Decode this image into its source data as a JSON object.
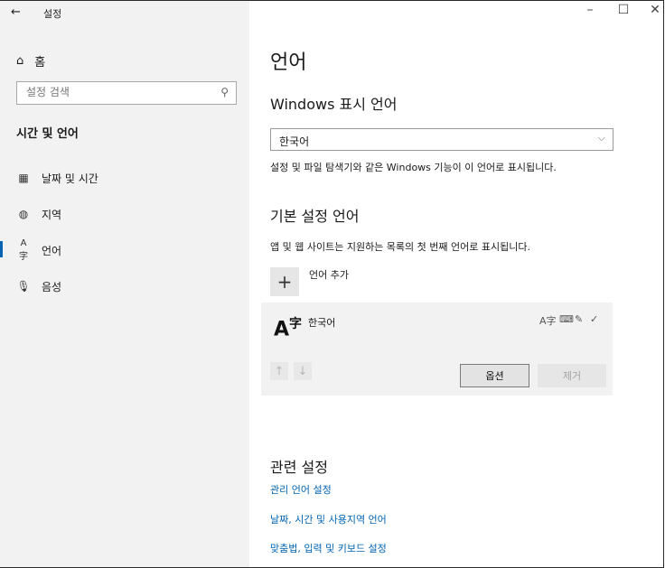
{
  "window": {
    "title": "설정",
    "back": "←",
    "minimize": "–",
    "maximize": "☐",
    "close": "✕"
  },
  "sidebar": {
    "home_label": "홈",
    "search_placeholder": "설정 검색",
    "section_title": "시간 및 언어",
    "items": [
      {
        "label": "날짜 및 시간",
        "icon": "calendar-clock-icon"
      },
      {
        "label": "지역",
        "icon": "globe-icon"
      },
      {
        "label": "언어",
        "icon": "language-icon"
      },
      {
        "label": "음성",
        "icon": "microphone-icon"
      }
    ]
  },
  "main": {
    "page_title": "언어",
    "display_language": {
      "heading": "Windows 표시 언어",
      "selected": "한국어",
      "description": "설정 및 파일 탐색기와 같은 Windows 기능이 이 언어로 표시됩니다."
    },
    "preferred": {
      "heading": "기본 설정 언어",
      "description": "앱 및 웹 사이트는 지원하는 목록의 첫 번째 언어로 표시됩니다.",
      "add_label": "언어 추가",
      "language": {
        "name": "한국어",
        "glyph": "A字"
      },
      "options_label": "옵션",
      "remove_label": "제거"
    },
    "related": {
      "heading": "관련 설정",
      "links": [
        "관리 언어 설정",
        "날짜, 시간 및 사용지역 언어",
        "맞춤법, 입력 및 키보드 설정"
      ]
    }
  },
  "colors": {
    "accent": "#0063b1",
    "sidebar_bg": "#f2f2f2",
    "card_bg": "#f2f2f2"
  }
}
